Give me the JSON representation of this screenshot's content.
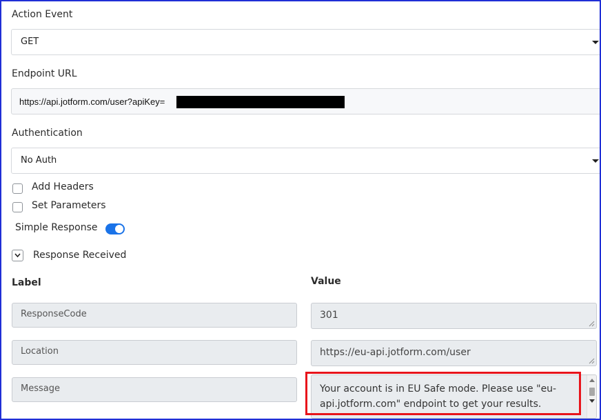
{
  "action_event": {
    "label": "Action Event",
    "selected": "GET"
  },
  "endpoint": {
    "label": "Endpoint URL",
    "value": "https://api.jotform.com/user?apiKey="
  },
  "authentication": {
    "label": "Authentication",
    "selected": "No Auth"
  },
  "options": {
    "add_headers": "Add Headers",
    "set_parameters": "Set Parameters",
    "simple_response": "Simple Response",
    "simple_response_on": true
  },
  "response": {
    "toggle_label": "Response Received",
    "label_header": "Label",
    "value_header": "Value",
    "rows": [
      {
        "label": "ResponseCode",
        "value": "301"
      },
      {
        "label": "Location",
        "value": "https://eu-api.jotform.com/user"
      },
      {
        "label": "Message",
        "value": "Your account is in EU Safe mode. Please use \"eu-api.jotform.com\" endpoint to get your results."
      }
    ]
  },
  "colors": {
    "accent": "#1a73e8",
    "highlight": "#e8141b",
    "frame": "#1f2fd6"
  }
}
